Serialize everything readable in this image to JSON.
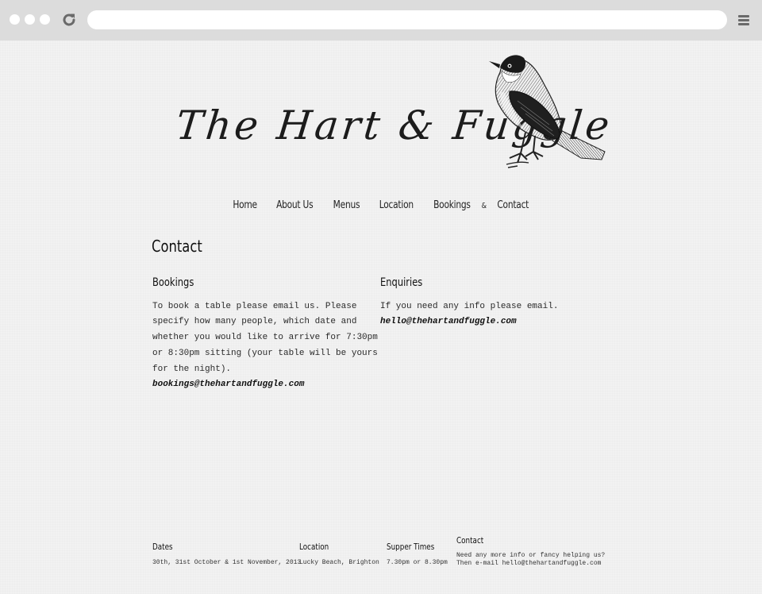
{
  "browser": {
    "url": ""
  },
  "header": {
    "logo_text": "The Hart & Fuggle"
  },
  "nav": {
    "items": [
      "Home",
      "About Us",
      "Menus",
      "Location",
      "Bookings",
      "&",
      "Contact"
    ]
  },
  "main": {
    "title": "Contact",
    "bookings": {
      "heading": "Bookings",
      "body": "To book a table please email us. Please specify how many people, which date and whether you would like to arrive for 7:30pm or 8:30pm sitting (your table will be yours for the night).",
      "email": "bookings@thehartandfuggle.com"
    },
    "enquiries": {
      "heading": "Enquiries",
      "body": "If you need any info please email.",
      "email": "hello@thehartandfuggle.com"
    }
  },
  "footer": {
    "dates": {
      "heading": "Dates",
      "text": "30th, 31st October & 1st November, 2013"
    },
    "location": {
      "heading": "Location",
      "text": "Lucky Beach, Brighton"
    },
    "supper": {
      "heading": "Supper Times",
      "text": "7.30pm or 8.30pm"
    },
    "contact": {
      "heading": "Contact",
      "line1": "Need any more info or fancy helping us?",
      "line2": "Then e-mail hello@thehartandfuggle.com"
    }
  },
  "icons": {
    "reload": "reload-icon",
    "menu": "hamburger-menu-icon",
    "bird": "bird-illustration"
  },
  "colors": {
    "chrome": "#dcdcdc",
    "page_bg": "#f2f2f2",
    "text": "#222222"
  }
}
